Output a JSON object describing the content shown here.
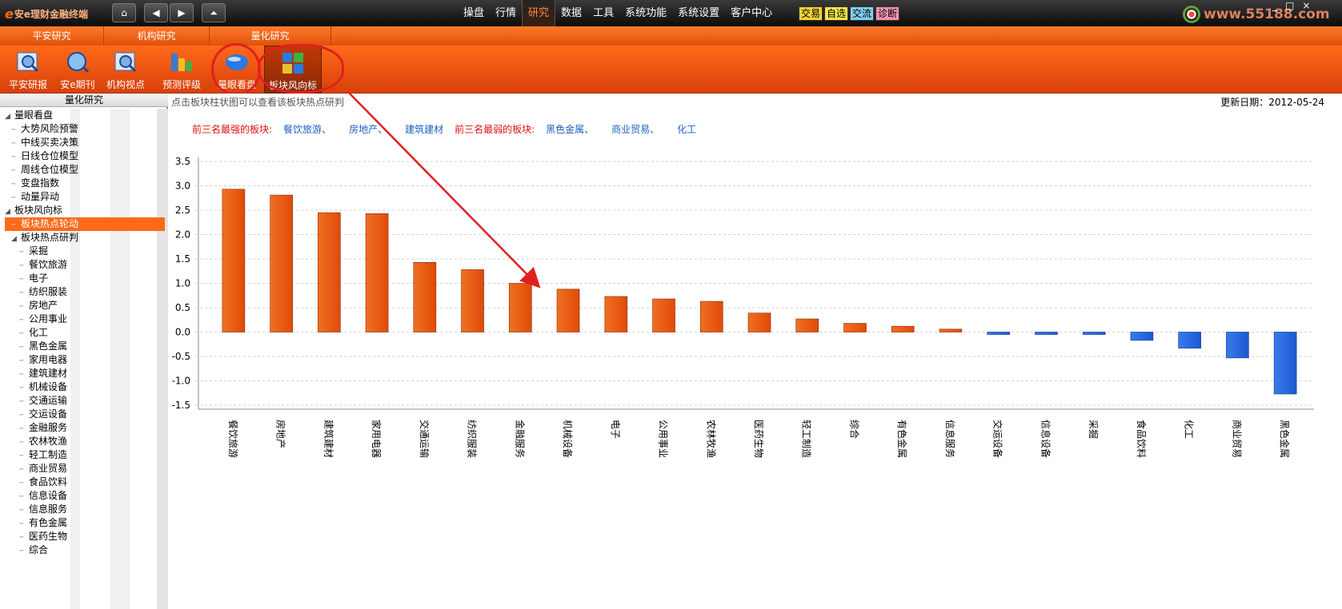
{
  "app": {
    "title": "安e理财金融终端"
  },
  "nav": {
    "home": "⌂",
    "back": "◀",
    "forward": "▶",
    "up": "⏶"
  },
  "menu": [
    "操盘",
    "行情",
    "研究",
    "数据",
    "工具",
    "系统功能",
    "系统设置",
    "客户中心"
  ],
  "menu_active": 2,
  "quick": [
    {
      "label": "交易",
      "color": "#f3d23a"
    },
    {
      "label": "自选",
      "color": "#f3e64a"
    },
    {
      "label": "交流",
      "color": "#7fd0f0"
    },
    {
      "label": "诊断",
      "color": "#f090b0"
    }
  ],
  "watermark": "www.55188.com",
  "sections": [
    "平安研究",
    "机构研究",
    "量化研究"
  ],
  "toolbar": [
    {
      "label": "平安研报"
    },
    {
      "label": "安e期刊"
    },
    {
      "label": "机构视点"
    },
    {
      "label": "预测评级"
    },
    {
      "label": "量眼看盘"
    },
    {
      "label": "板块风向标"
    }
  ],
  "sidebar": {
    "title": "量化研究",
    "items": [
      {
        "label": "量眼看盘",
        "level": 0,
        "expand": true
      },
      {
        "label": "大势风险预警",
        "level": 1
      },
      {
        "label": "中线买卖决策",
        "level": 1
      },
      {
        "label": "日线仓位模型",
        "level": 1
      },
      {
        "label": "周线仓位模型",
        "level": 1
      },
      {
        "label": "变盘指数",
        "level": 1
      },
      {
        "label": "动量异动",
        "level": 1
      },
      {
        "label": "板块风向标",
        "level": 0,
        "expand": true
      },
      {
        "label": "板块热点轮动",
        "level": 1,
        "selected": true
      },
      {
        "label": "板块热点研判",
        "level": 1,
        "expand": true
      },
      {
        "label": "采掘",
        "level": 2
      },
      {
        "label": "餐饮旅游",
        "level": 2
      },
      {
        "label": "电子",
        "level": 2
      },
      {
        "label": "纺织服装",
        "level": 2
      },
      {
        "label": "房地产",
        "level": 2
      },
      {
        "label": "公用事业",
        "level": 2
      },
      {
        "label": "化工",
        "level": 2
      },
      {
        "label": "黑色金属",
        "level": 2
      },
      {
        "label": "家用电器",
        "level": 2
      },
      {
        "label": "建筑建材",
        "level": 2
      },
      {
        "label": "机械设备",
        "level": 2
      },
      {
        "label": "交通运输",
        "level": 2
      },
      {
        "label": "交运设备",
        "level": 2
      },
      {
        "label": "金融服务",
        "level": 2
      },
      {
        "label": "农林牧渔",
        "level": 2
      },
      {
        "label": "轻工制造",
        "level": 2
      },
      {
        "label": "商业贸易",
        "level": 2
      },
      {
        "label": "食品饮料",
        "level": 2
      },
      {
        "label": "信息设备",
        "level": 2
      },
      {
        "label": "信息服务",
        "level": 2
      },
      {
        "label": "有色金属",
        "level": 2
      },
      {
        "label": "医药生物",
        "level": 2
      },
      {
        "label": "综合",
        "level": 2
      }
    ]
  },
  "content": {
    "hint": "点击板块柱状图可以查看该板块热点研判",
    "update_label": "更新日期：",
    "update_date": "2012-05-24",
    "strong_label": "前三名最强的板块:",
    "strong": [
      "餐饮旅游、",
      "房地产、",
      "建筑建材"
    ],
    "weak_label": "前三名最弱的板块:",
    "weak": [
      "黑色金属、",
      "商业贸易、",
      "化工"
    ]
  },
  "chart_data": {
    "type": "bar",
    "categories": [
      "餐饮旅游",
      "房地产",
      "建筑建材",
      "家用电器",
      "交通运输",
      "纺织服装",
      "金融服务",
      "机械设备",
      "电子",
      "公用事业",
      "农林牧渔",
      "医药生物",
      "轻工制造",
      "综合",
      "有色金属",
      "信息服务",
      "交运设备",
      "信息设备",
      "采掘",
      "食品饮料",
      "化工",
      "商业贸易",
      "黑色金属"
    ],
    "values": [
      2.93,
      2.81,
      2.45,
      2.43,
      1.43,
      1.28,
      1.0,
      0.88,
      0.73,
      0.68,
      0.63,
      0.39,
      0.27,
      0.18,
      0.12,
      0.06,
      -0.05,
      -0.05,
      -0.05,
      -0.17,
      -0.33,
      -0.53,
      -1.27
    ],
    "ylim": [
      -1.5,
      3.5
    ],
    "yticks": [
      "3.5",
      "3.0",
      "2.5",
      "2.0",
      "1.5",
      "1.0",
      "0.5",
      "0.0",
      "-0.5",
      "-1.0",
      "-1.5"
    ],
    "grid": true,
    "colors": {
      "positive": "#e04a0a",
      "negative": "#1a5ad0"
    }
  }
}
